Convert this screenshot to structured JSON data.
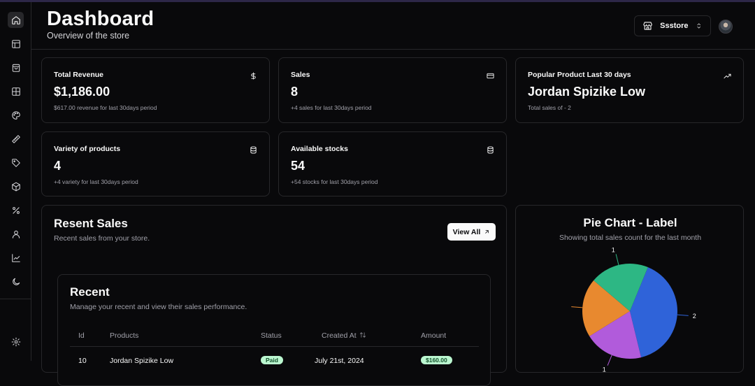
{
  "header": {
    "title": "Dashboard",
    "subtitle": "Overview of the store",
    "store_name": "Ssstore"
  },
  "sidebar": {
    "items": [
      {
        "icon": "home-icon"
      },
      {
        "icon": "layout-icon"
      },
      {
        "icon": "shopping-bag-icon"
      },
      {
        "icon": "grid-icon"
      },
      {
        "icon": "palette-icon"
      },
      {
        "icon": "ruler-icon"
      },
      {
        "icon": "tag-icon"
      },
      {
        "icon": "package-icon"
      },
      {
        "icon": "percent-icon"
      },
      {
        "icon": "user-icon"
      },
      {
        "icon": "line-chart-icon"
      },
      {
        "icon": "moon-icon"
      },
      {
        "icon": "settings-icon"
      }
    ]
  },
  "stats": {
    "revenue": {
      "label": "Total Revenue",
      "value": "$1,186.00",
      "note": "$617.00 revenue for last 30days period",
      "icon": "dollar-icon"
    },
    "sales": {
      "label": "Sales",
      "value": "8",
      "note": "+4 sales for last 30days period",
      "icon": "credit-card-icon"
    },
    "popular": {
      "label": "Popular Product Last 30 days",
      "value": "Jordan Spizike Low",
      "note": "Total sales of - 2",
      "icon": "trending-up-icon"
    },
    "variety": {
      "label": "Variety of products",
      "value": "4",
      "note": "+4 variety for last 30days period",
      "icon": "database-icon"
    },
    "stocks": {
      "label": "Available stocks",
      "value": "54",
      "note": "+54 stocks for last 30days period",
      "icon": "database-icon"
    }
  },
  "recent_sales": {
    "title": "Resent Sales",
    "subtitle": "Recent sales from your store.",
    "view_all": "View All",
    "table": {
      "title": "Recent",
      "subtitle": "Manage your recent and view their sales performance.",
      "columns": [
        "Id",
        "Products",
        "Status",
        "Created At",
        "Amount"
      ],
      "rows": [
        {
          "id": "10",
          "product": "Jordan Spizike Low",
          "status": "Paid",
          "created": "July 21st, 2024",
          "amount": "$160.00"
        }
      ]
    }
  },
  "pie": {
    "title": "Pie Chart - Label",
    "subtitle": "Showing total sales count for the last month"
  },
  "chart_data": {
    "type": "pie",
    "title": "Pie Chart - Label",
    "subtitle": "Showing total sales count for the last month",
    "slices": [
      {
        "value": 2,
        "label": "2",
        "color": "#2f63d9"
      },
      {
        "value": 1,
        "label": "1",
        "color": "#b15bdb"
      },
      {
        "value": 1,
        "label": "",
        "color": "#e8892f"
      },
      {
        "value": 1,
        "label": "1",
        "color": "#2db784"
      }
    ]
  }
}
